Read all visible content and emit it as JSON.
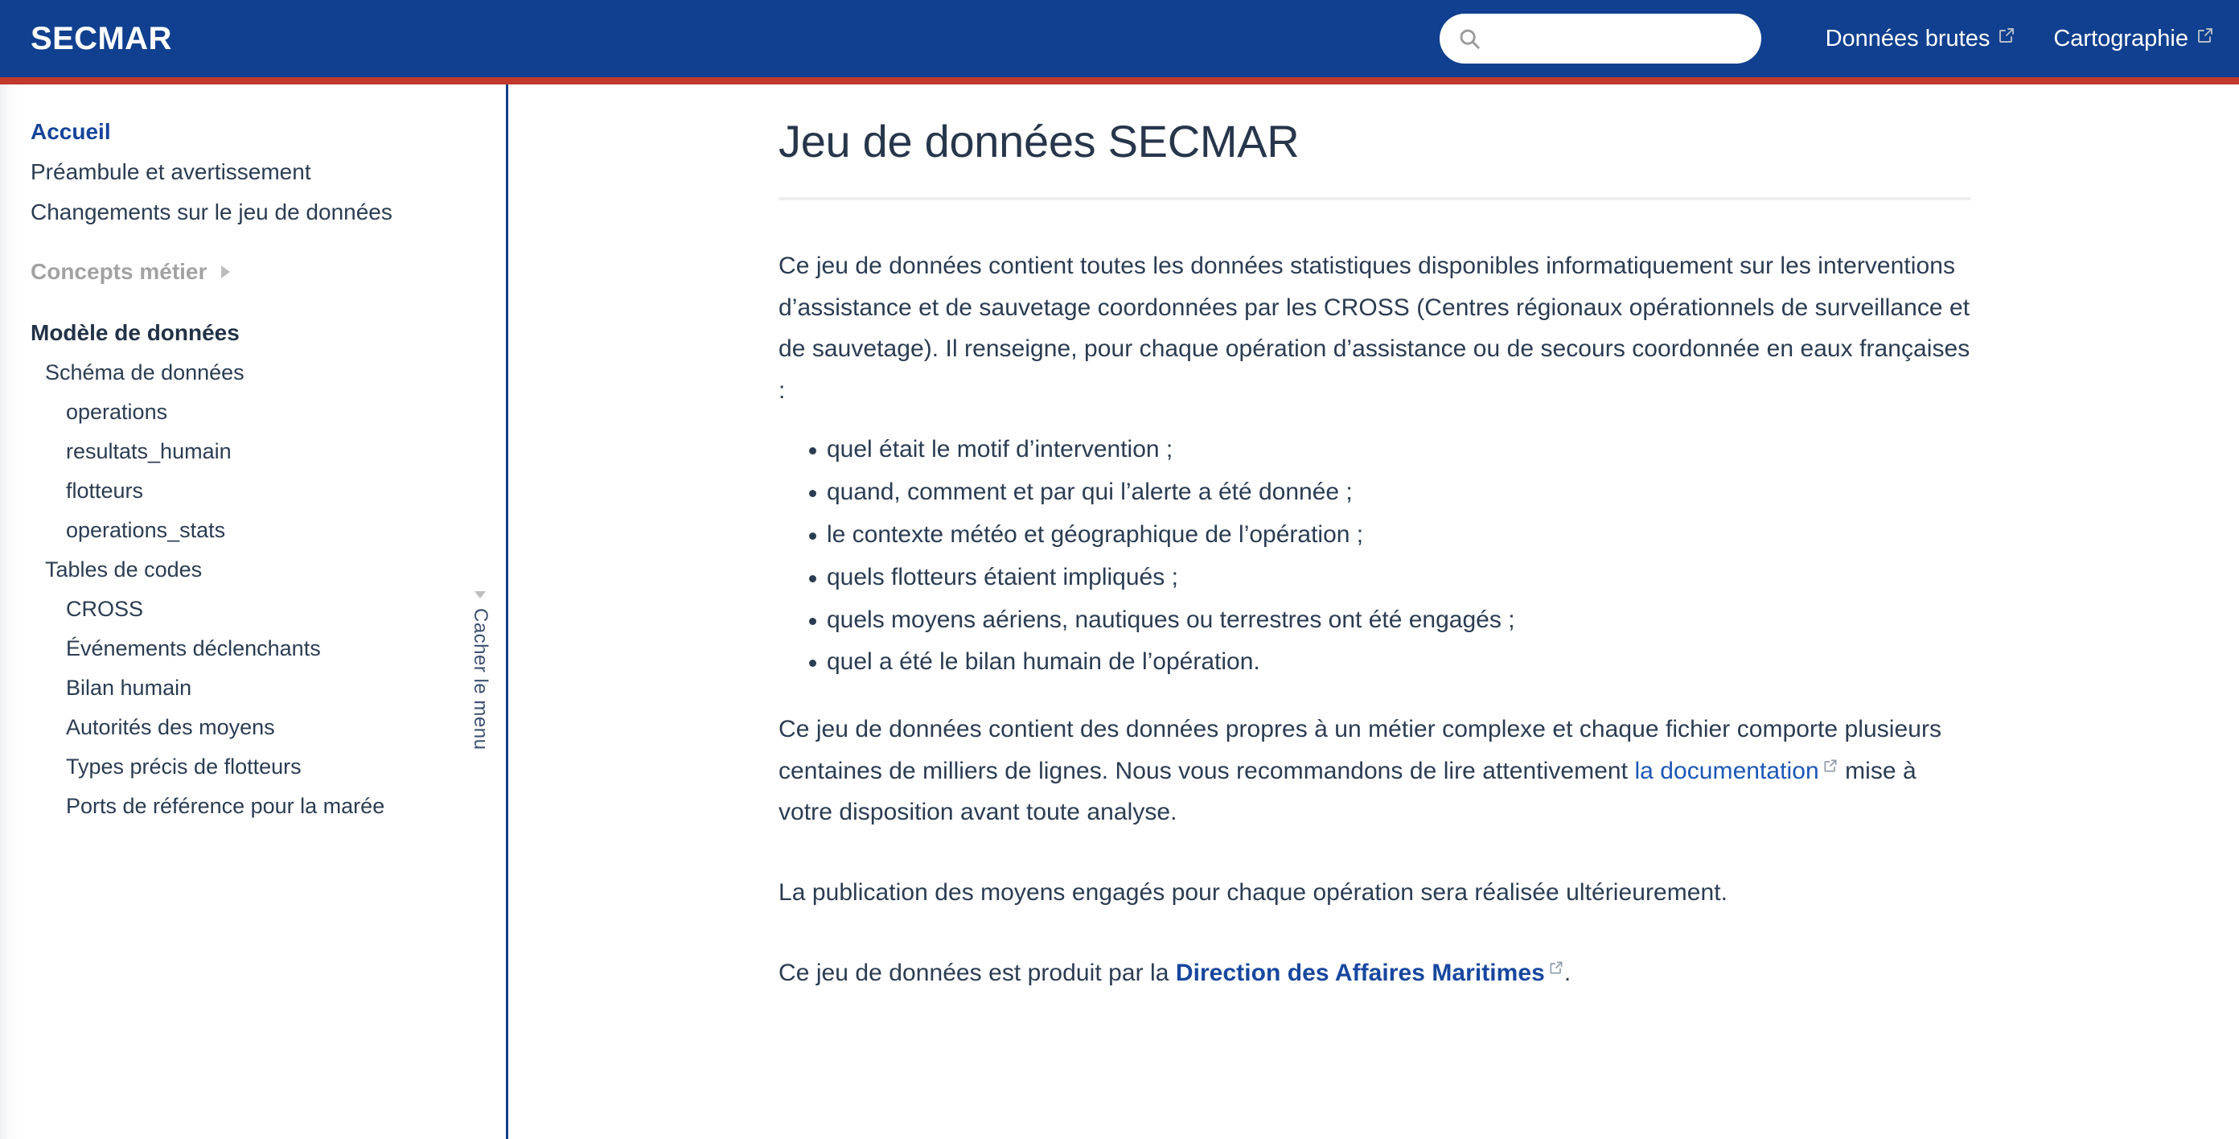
{
  "header": {
    "brand": "SECMAR",
    "search": {
      "value": "",
      "placeholder": "",
      "icon": "search-icon"
    },
    "links": [
      {
        "label": "Données brutes",
        "icon": "external-link-icon"
      },
      {
        "label": "Cartographie",
        "icon": "external-link-icon"
      }
    ],
    "colors": {
      "background": "#10408f",
      "accent_stripe": "#c0392b",
      "text": "#ffffff"
    }
  },
  "sidebar": {
    "collapse_label": "Cacher le menu",
    "collapse_icon": "triangle-left-icon",
    "items": [
      {
        "label": "Accueil",
        "level": 0,
        "state": "active"
      },
      {
        "label": "Préambule et avertissement",
        "level": 0,
        "state": "normal"
      },
      {
        "label": "Changements sur le jeu de données",
        "level": 0,
        "state": "normal"
      },
      {
        "label": "Concepts métier",
        "level": 0,
        "state": "group",
        "icon": "chevron-right-icon"
      },
      {
        "label": "Modèle de données",
        "level": 0,
        "state": "section"
      },
      {
        "label": "Schéma de données",
        "level": 1,
        "state": "normal"
      },
      {
        "label": "operations",
        "level": 2,
        "state": "normal"
      },
      {
        "label": "resultats_humain",
        "level": 2,
        "state": "normal"
      },
      {
        "label": "flotteurs",
        "level": 2,
        "state": "normal"
      },
      {
        "label": "operations_stats",
        "level": 2,
        "state": "normal"
      },
      {
        "label": "Tables de codes",
        "level": 1,
        "state": "normal"
      },
      {
        "label": "CROSS",
        "level": 2,
        "state": "normal"
      },
      {
        "label": "Événements déclenchants",
        "level": 2,
        "state": "normal"
      },
      {
        "label": "Bilan humain",
        "level": 2,
        "state": "normal"
      },
      {
        "label": "Autorités des moyens",
        "level": 2,
        "state": "normal"
      },
      {
        "label": "Types précis de flotteurs",
        "level": 2,
        "state": "normal"
      },
      {
        "label": "Ports de référence pour la marée",
        "level": 2,
        "state": "normal"
      }
    ],
    "colors": {
      "active": "#16449b",
      "text": "#2b3c52",
      "group": "#a2a2a2",
      "divider": "#123d8a"
    }
  },
  "main": {
    "title": "Jeu de données SECMAR",
    "paragraph_1": "Ce jeu de données contient toutes les données statistiques disponibles informatiquement sur les interventions d’assistance et de sauvetage coordonnées par les CROSS (Centres régionaux opérationnels de surveillance et de sauvetage). Il renseigne, pour chaque opération d’assistance ou de secours coordonnée en eaux françaises :",
    "bullets": [
      "quel était le motif d’intervention ;",
      "quand, comment et par qui l’alerte a été donnée ;",
      "le contexte météo et géographique de l’opération ;",
      "quels flotteurs étaient impliqués ;",
      "quels moyens aériens, nautiques ou terrestres ont été engagés ;",
      "quel a été le bilan humain de l’opération."
    ],
    "paragraph_2_before": "Ce jeu de données contient des données propres à un métier complexe et chaque fichier comporte plusieurs centaines de milliers de lignes. Nous vous recommandons de lire attentivement ",
    "paragraph_2_link": "la documentation",
    "paragraph_2_after": " mise à votre disposition avant toute analyse.",
    "paragraph_3": "La publication des moyens engagés pour chaque opération sera réalisée ultérieurement.",
    "paragraph_4_before": "Ce jeu de données est produit par la ",
    "paragraph_4_link": "Direction des Affaires Maritimes",
    "paragraph_4_after": ".",
    "link_icon": "external-link-icon",
    "colors": {
      "text": "#2b3c52",
      "link": "#1c57b5",
      "title": "#27364b",
      "rule": "#eeeef0"
    }
  }
}
